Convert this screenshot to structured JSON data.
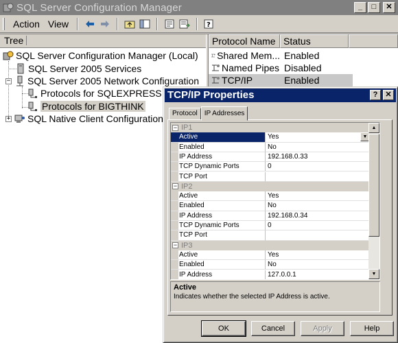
{
  "window": {
    "title": "SQL Server Configuration Manager",
    "controls": [
      "_",
      "□",
      "✕"
    ]
  },
  "menu": {
    "action": "Action",
    "view": "View"
  },
  "tree": {
    "header": "Tree",
    "root": "SQL Server Configuration Manager (Local)",
    "services": "SQL Server 2005 Services",
    "network": "SQL Server 2005 Network Configuration",
    "proto_express": "Protocols for SQLEXPRESS",
    "proto_bigthink": "Protocols for BIGTHINK",
    "native_client": "SQL Native Client Configuration"
  },
  "list": {
    "columns": [
      "Protocol Name",
      "Status"
    ],
    "rows": [
      {
        "name": "Shared Mem...",
        "status": "Enabled"
      },
      {
        "name": "Named Pipes",
        "status": "Disabled"
      },
      {
        "name": "TCP/IP",
        "status": "Enabled"
      }
    ]
  },
  "dialog": {
    "title": "TCP/IP Properties",
    "help_btn": "?",
    "close_btn": "✕",
    "tabs": [
      "Protocol",
      "IP Addresses"
    ],
    "groups": [
      {
        "name": "IP1",
        "rows": [
          {
            "k": "Active",
            "v": "Yes"
          },
          {
            "k": "Enabled",
            "v": "No"
          },
          {
            "k": "IP Address",
            "v": "192.168.0.33"
          },
          {
            "k": "TCP Dynamic Ports",
            "v": "0"
          },
          {
            "k": "TCP Port",
            "v": ""
          }
        ]
      },
      {
        "name": "IP2",
        "rows": [
          {
            "k": "Active",
            "v": "Yes"
          },
          {
            "k": "Enabled",
            "v": "No"
          },
          {
            "k": "IP Address",
            "v": "192.168.0.34"
          },
          {
            "k": "TCP Dynamic Ports",
            "v": "0"
          },
          {
            "k": "TCP Port",
            "v": ""
          }
        ]
      },
      {
        "name": "IP3",
        "rows": [
          {
            "k": "Active",
            "v": "Yes"
          },
          {
            "k": "Enabled",
            "v": "No"
          },
          {
            "k": "IP Address",
            "v": "127.0.0.1"
          }
        ]
      }
    ],
    "desc_title": "Active",
    "desc_text": "Indicates whether the selected IP Address is active.",
    "buttons": {
      "ok": "OK",
      "cancel": "Cancel",
      "apply": "Apply",
      "help": "Help"
    }
  }
}
